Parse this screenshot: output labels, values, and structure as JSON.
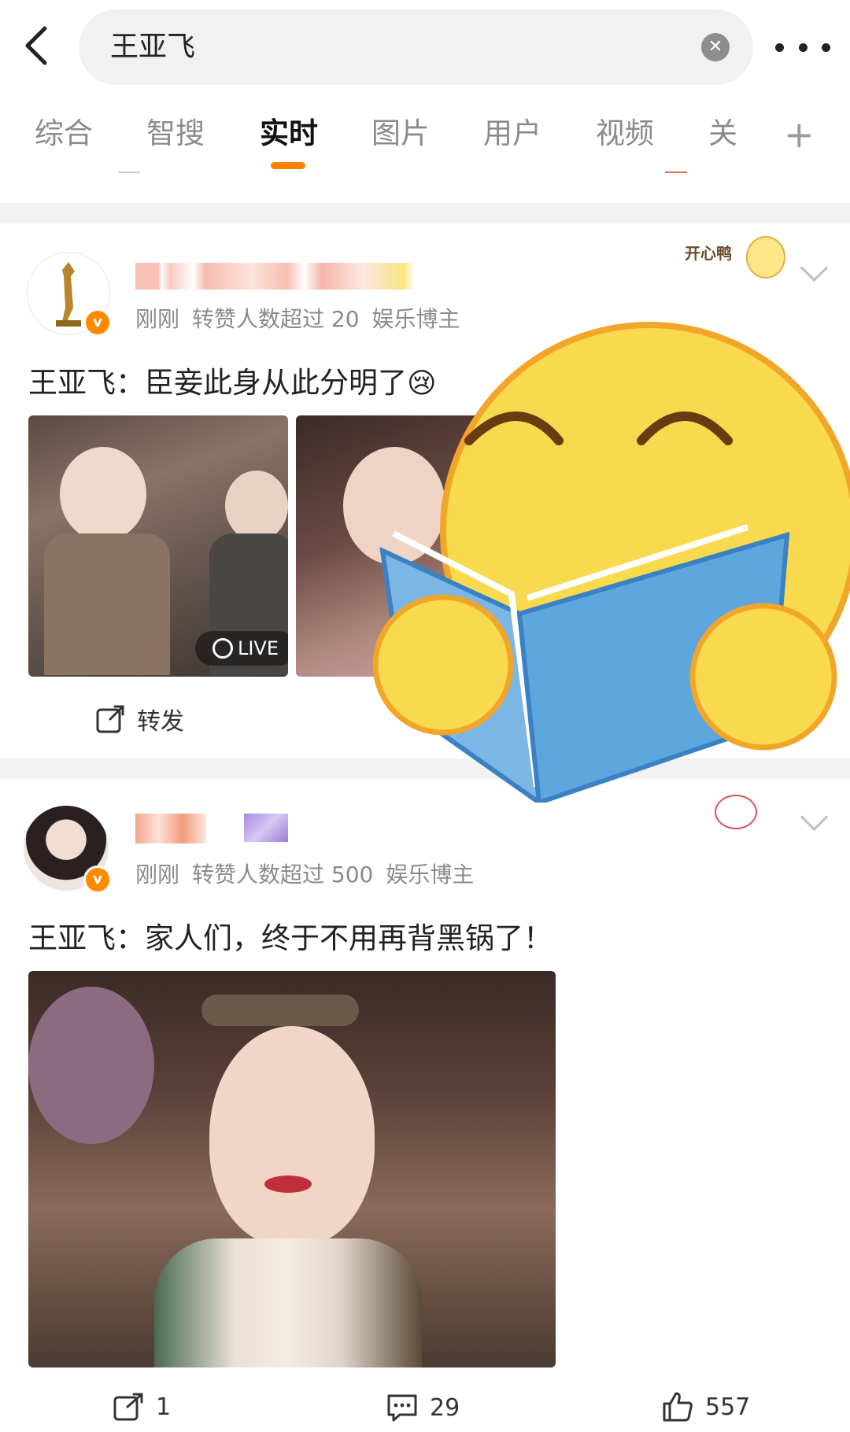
{
  "search": {
    "query": "王亚飞",
    "clear_icon": "close-icon"
  },
  "tabs": [
    {
      "label": "综合"
    },
    {
      "label": "智搜"
    },
    {
      "label": "实时"
    },
    {
      "label": "图片"
    },
    {
      "label": "用户"
    },
    {
      "label": "视频"
    },
    {
      "label": "关注"
    }
  ],
  "tab_add_label": "+",
  "accent_color": "#ff8200",
  "posts": [
    {
      "meta": [
        "刚刚",
        "转赞人数超过 20",
        "娱乐博主"
      ],
      "text": "王亚飞：臣妾此身从此分明了",
      "live_badge": "LIVE",
      "actions": {
        "repost_label": "转发"
      }
    },
    {
      "meta": [
        "刚刚",
        "转赞人数超过 500",
        "娱乐博主"
      ],
      "text": "王亚飞：家人们，终于不用再背黑锅了！",
      "actions": {
        "repost_count": "1",
        "comment_count": "29",
        "like_count": "557"
      }
    }
  ],
  "sticker_text": "开心鸭",
  "verified_badge": "v"
}
